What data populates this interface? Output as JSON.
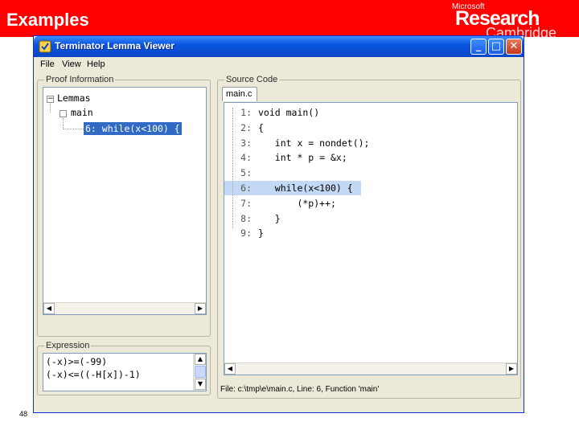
{
  "slide": {
    "title": "Examples",
    "brand_line1": "Microsoft",
    "brand_line2": "Research",
    "brand_line3": "Cambridge",
    "page_number": "48",
    "accent_color": "#ff0000"
  },
  "window": {
    "title": "Terminator Lemma Viewer",
    "minimize": "_",
    "maximize": "□",
    "close": "✕",
    "menu": [
      "File",
      "View",
      "Help"
    ]
  },
  "proof_panel": {
    "label": "Proof Information",
    "tree": {
      "root": "Lemmas",
      "child": "main",
      "leaf": "6: while(x<100) {"
    }
  },
  "expression_panel": {
    "label": "Expression",
    "lines": [
      "(-x)>=(-99)",
      "(-x)<=((-H[x])-1)"
    ]
  },
  "source_panel": {
    "label": "Source Code",
    "tab": "main.c",
    "lines": [
      {
        "num": "1:",
        "code": "void main()"
      },
      {
        "num": "2:",
        "code": "{"
      },
      {
        "num": "3:",
        "code": "   int x = nondet();"
      },
      {
        "num": "4:",
        "code": "   int * p = &x;"
      },
      {
        "num": "5:",
        "code": ""
      },
      {
        "num": "6:",
        "code": "   while(x<100) {"
      },
      {
        "num": "7:",
        "code": "       (*p)++;"
      },
      {
        "num": "8:",
        "code": "   }"
      },
      {
        "num": "9:",
        "code": "}"
      }
    ],
    "highlighted_line": "6:",
    "status": "File: c:\\tmp\\e\\main.c,  Line: 6,  Function 'main'"
  }
}
